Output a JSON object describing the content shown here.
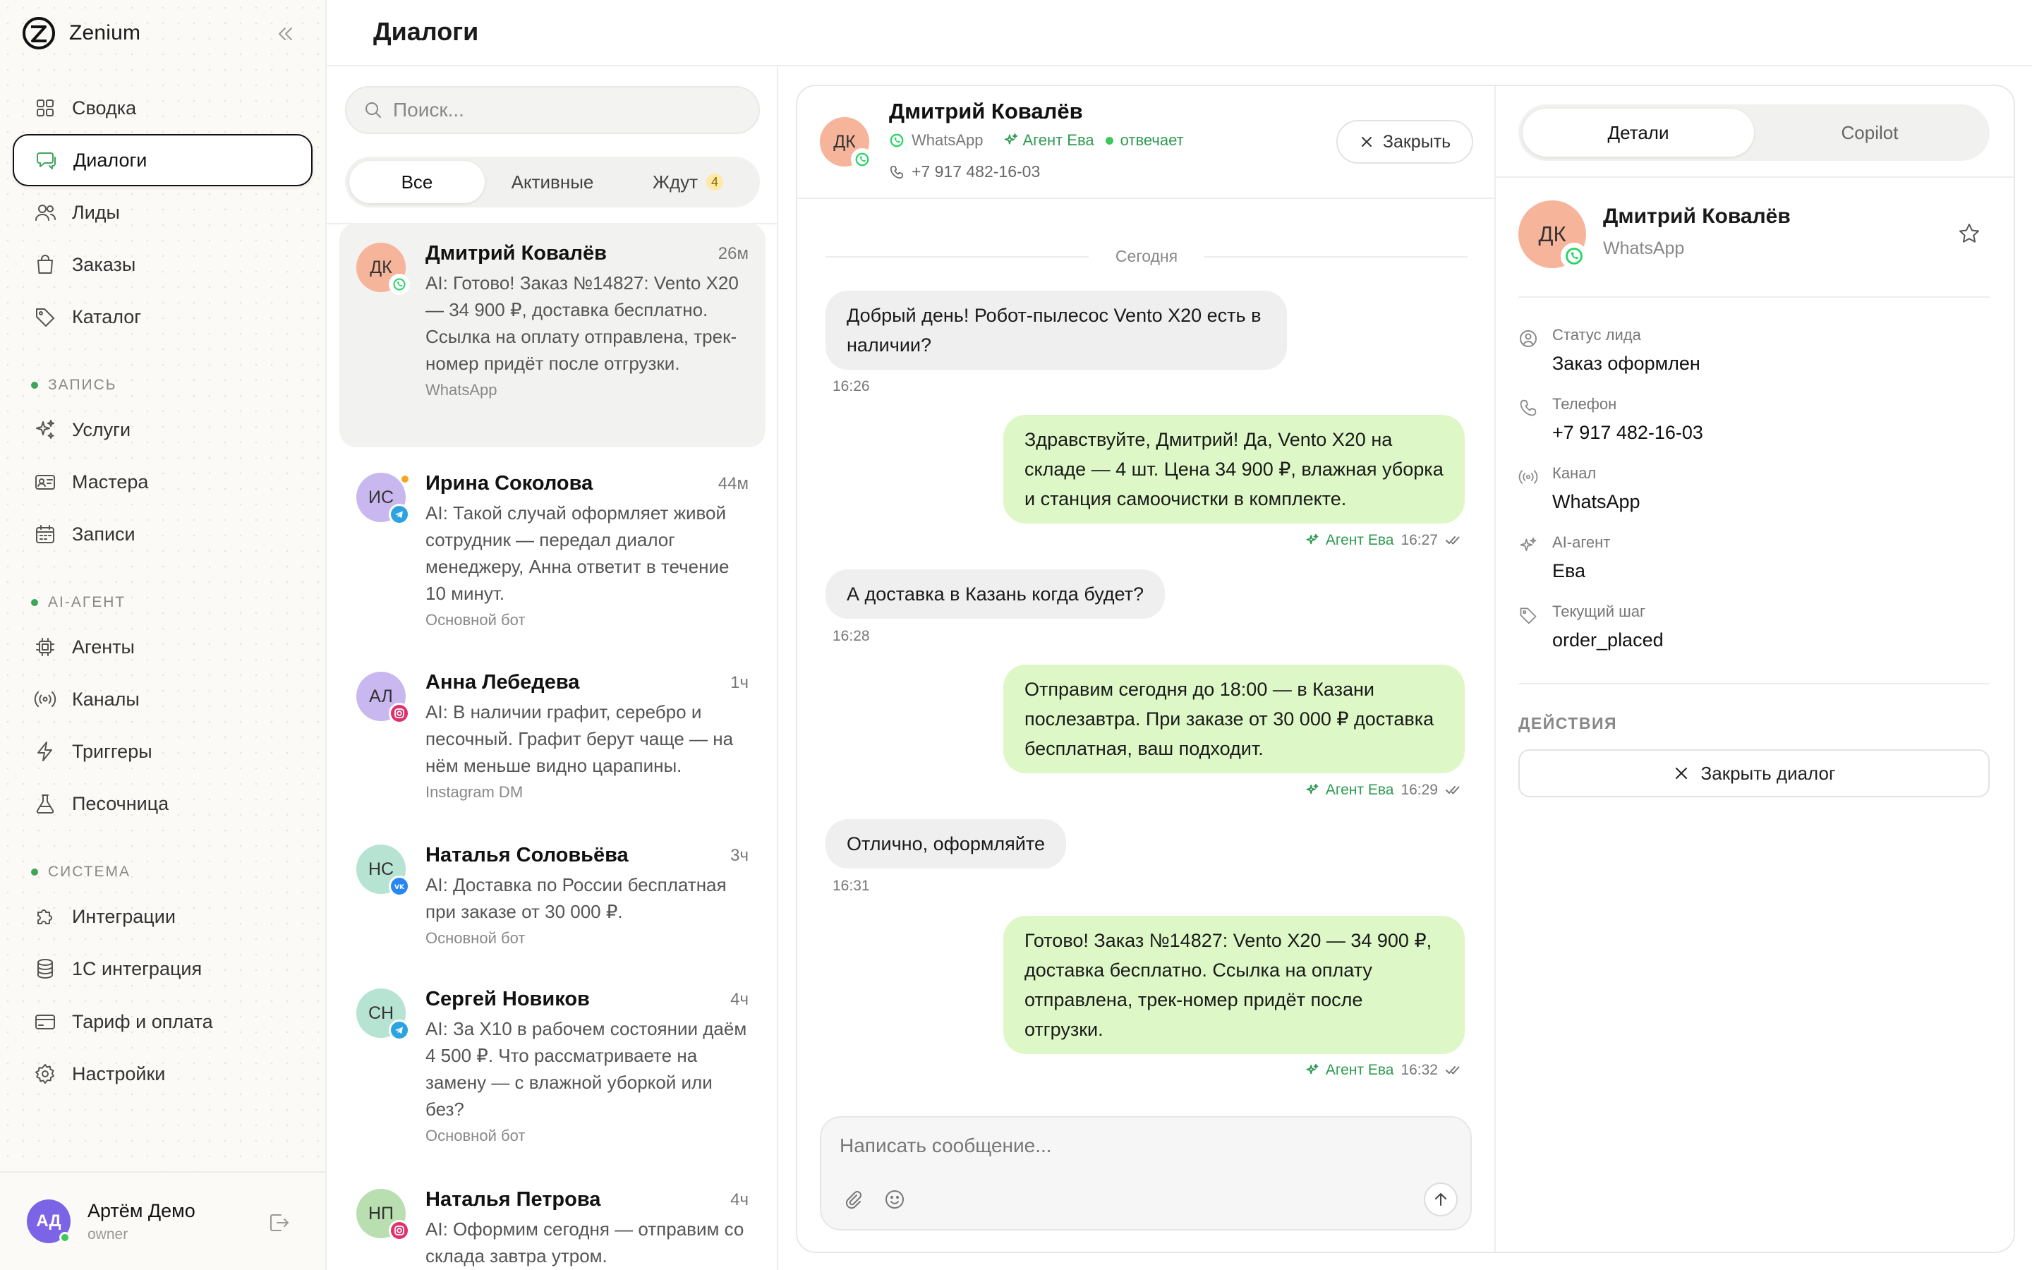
{
  "app": {
    "name": "Zenium"
  },
  "page": {
    "title": "Диалоги"
  },
  "sidebar": {
    "items": [
      {
        "label": "Сводка"
      },
      {
        "label": "Диалоги"
      },
      {
        "label": "Лиды"
      },
      {
        "label": "Заказы"
      },
      {
        "label": "Каталог"
      },
      {
        "label": "Услуги"
      },
      {
        "label": "Мастера"
      },
      {
        "label": "Записи"
      },
      {
        "label": "Агенты"
      },
      {
        "label": "Каналы"
      },
      {
        "label": "Триггеры"
      },
      {
        "label": "Песочница"
      },
      {
        "label": "Интеграции"
      },
      {
        "label": "1С интеграция"
      },
      {
        "label": "Тариф и оплата"
      },
      {
        "label": "Настройки"
      }
    ],
    "sections": {
      "booking": "ЗАПИСЬ",
      "ai": "AI-АГЕНТ",
      "system": "СИСТЕМА"
    },
    "user": {
      "initials": "АД",
      "name": "Артём Демо",
      "role": "owner"
    }
  },
  "search": {
    "placeholder": "Поиск..."
  },
  "filters": {
    "all": "Все",
    "active": "Активные",
    "waiting": "Ждут",
    "waiting_count": "4"
  },
  "conversations": [
    {
      "initials": "ДК",
      "name": "Дмитрий Ковалёв",
      "time": "26м",
      "preview": "AI: Готово! Заказ №14827: Vento X20 — 34 900 ₽, доставка бесплатно. Ссылка на оплату отправлена, трек-номер придёт после отгрузки.",
      "source": "WhatsApp"
    },
    {
      "initials": "ИС",
      "name": "Ирина Соколова",
      "time": "44м",
      "preview": "AI: Такой случай оформляет живой сотрудник — передал диалог менеджеру, Анна ответит в течение 10 минут.",
      "source": "Основной бот"
    },
    {
      "initials": "АЛ",
      "name": "Анна Лебедева",
      "time": "1ч",
      "preview": "AI: В наличии графит, серебро и песочный. Графит берут чаще — на нём меньше видно царапины.",
      "source": "Instagram DM"
    },
    {
      "initials": "НС",
      "name": "Наталья Соловьёва",
      "time": "3ч",
      "preview": "AI: Доставка по России бесплатная при заказе от 30 000 ₽.",
      "source": "Основной бот"
    },
    {
      "initials": "СН",
      "name": "Сергей Новиков",
      "time": "4ч",
      "preview": "AI: За X10 в рабочем состоянии даём 4 500 ₽. Что рассматриваете на замену — с влажной уборкой или без?",
      "source": "Основной бот"
    },
    {
      "initials": "НП",
      "name": "Наталья Петрова",
      "time": "4ч",
      "preview": "AI: Оформим сегодня — отправим со склада завтра утром.",
      "source": ""
    }
  ],
  "chat": {
    "contact": {
      "initials": "ДК",
      "name": "Дмитрий Ковалёв",
      "channel": "WhatsApp",
      "agent": "Агент Ева",
      "status": "отвечает",
      "phone": "+7 917 482-16-03"
    },
    "close_label": "Закрыть",
    "day": "Сегодня",
    "messages": [
      {
        "dir": "in",
        "text": "Добрый день! Робот-пылесос Vento X20 есть в наличии?",
        "time": "16:26"
      },
      {
        "dir": "out",
        "text": "Здравствуйте, Дмитрий! Да, Vento X20 на складе — 4 шт. Цена 34 900 ₽, влажная уборка и станция самоочистки в комплекте.",
        "agent": "Агент Ева",
        "time": "16:27"
      },
      {
        "dir": "in",
        "text": "А доставка в Казань когда будет?",
        "time": "16:28"
      },
      {
        "dir": "out",
        "text": "Отправим сегодня до 18:00 — в Казани послезавтра. При заказе от 30 000 ₽ доставка бесплатная, ваш подходит.",
        "agent": "Агент Ева",
        "time": "16:29"
      },
      {
        "dir": "in",
        "text": "Отлично, оформляйте",
        "time": "16:31"
      },
      {
        "dir": "out",
        "text": "Готово! Заказ №14827: Vento X20 — 34 900 ₽, доставка бесплатно. Ссылка на оплату отправлена, трек-номер придёт после отгрузки.",
        "agent": "Агент Ева",
        "time": "16:32"
      }
    ],
    "composer_placeholder": "Написать сообщение..."
  },
  "details": {
    "tabs": {
      "details": "Детали",
      "copilot": "Copilot"
    },
    "name": "Дмитрий Ковалёв",
    "channel": "WhatsApp",
    "fields": [
      {
        "label": "Статус лида",
        "value": "Заказ оформлен"
      },
      {
        "label": "Телефон",
        "value": "+7 917 482-16-03"
      },
      {
        "label": "Канал",
        "value": "WhatsApp"
      },
      {
        "label": "AI-агент",
        "value": "Ева"
      },
      {
        "label": "Текущий шаг",
        "value": "order_placed"
      }
    ],
    "actions_title": "ДЕЙСТВИЯ",
    "close_dialog": "Закрыть диалог"
  },
  "colors": {
    "accent": "#3ea65a",
    "bubble_out": "#ddf8c6",
    "bubble_in": "#efefef",
    "whatsapp": "#25d366",
    "telegram": "#2aa3e0",
    "instagram": "#e1306c",
    "vk": "#2787f5"
  }
}
